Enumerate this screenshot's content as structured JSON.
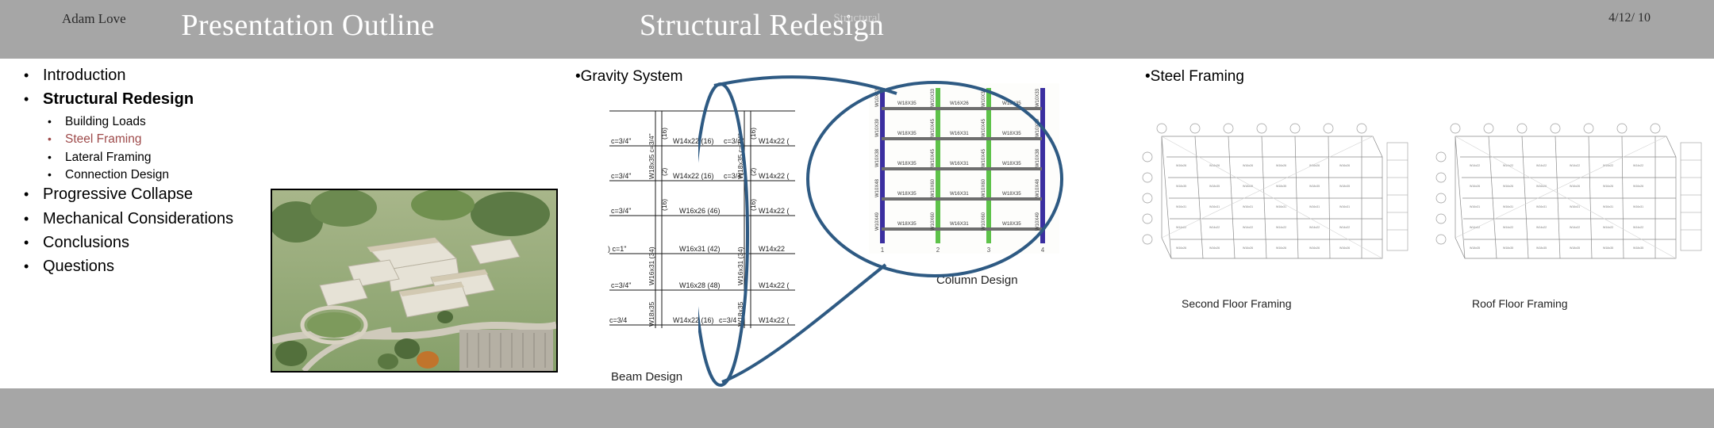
{
  "header": {
    "left_title": "Presentation Outline",
    "right_title": "Structural Redesign",
    "bar_color": "#a6a6a6"
  },
  "outline": {
    "items": [
      {
        "label": "Introduction",
        "level": 1,
        "bold": false,
        "highlight": false
      },
      {
        "label": "Structural Redesign",
        "level": 1,
        "bold": true,
        "highlight": false
      },
      {
        "label": "Building Loads",
        "level": 2,
        "bold": false,
        "highlight": false
      },
      {
        "label": "Steel Framing",
        "level": 2,
        "bold": false,
        "highlight": true
      },
      {
        "label": "Lateral Framing",
        "level": 2,
        "bold": false,
        "highlight": false
      },
      {
        "label": "Connection Design",
        "level": 2,
        "bold": false,
        "highlight": false
      },
      {
        "label": "Progressive Collapse",
        "level": 1,
        "bold": false,
        "highlight": false
      },
      {
        "label": "Mechanical Considerations",
        "level": 1,
        "bold": false,
        "highlight": false
      },
      {
        "label": "Conclusions",
        "level": 1,
        "bold": false,
        "highlight": false
      },
      {
        "label": "Questions",
        "level": 1,
        "bold": false,
        "highlight": false
      }
    ],
    "bullet_glyph": "•",
    "highlight_color": "#9e4a4a"
  },
  "photo": {
    "alt": "aerial-campus-rendering"
  },
  "gravity": {
    "label": "•Gravity System",
    "beam_caption": "Beam Design",
    "column_caption": "Column Design",
    "beam_plan": {
      "rows": [
        {
          "left_note": "c=3/4\"",
          "member": "W14x22 (16)",
          "mid_note": "c=3/4\"",
          "right_member": "W14x22 ("
        },
        {
          "left_note": "c=3/4\"",
          "member": "W14x22 (16)",
          "mid_note": "c=3/4\"",
          "right_member": "W14x22 ("
        },
        {
          "left_note": "c=3/4\"",
          "member": "W16x26 (46)",
          "mid_note": "",
          "right_member": "W14x22 ("
        },
        {
          "left_note": "c=1\"",
          "member": "W16x31 (42)",
          "mid_note": "",
          "right_member": "W14x22"
        },
        {
          "left_note": "c=3/4\"",
          "member": "W16x28 (48)",
          "mid_note": "",
          "right_member": "W14x22 ("
        },
        {
          "left_note": "c=3/4\"",
          "member": "W14x22 (16)",
          "mid_note": "c=3/4\"",
          "right_member": "W14x22 ("
        }
      ],
      "vertical_girders": [
        "W18x35  c=3/4\"",
        "(16)",
        "W18x35  c=3/4\"",
        "(2)",
        "W16x31 (34)",
        "W16x31 (34)",
        "W18x35 c=3/4\""
      ]
    },
    "column_detail": {
      "grid_labels": [
        "1",
        "2",
        "3",
        "4"
      ],
      "beam_labels_bay1": [
        "W18X35",
        "W18X35",
        "W18X35",
        "W18X35",
        "W18X35"
      ],
      "beam_labels_bay2": [
        "W16X26",
        "W16X31",
        "W16X31",
        "W16X31",
        "W16X31"
      ],
      "beam_labels_bay3": [
        "W18X35",
        "W18X35",
        "W18X35",
        "W18X35",
        "W18X35"
      ],
      "column_labels_outer": [
        "W10X33",
        "W10X39",
        "W10X38",
        "W10X48",
        "W10X49"
      ],
      "column_labels_inner": [
        "W10X33",
        "W10X45",
        "W10X45",
        "W10X60",
        "W10X60"
      ],
      "outer_column_color": "#3b2fa0",
      "inner_column_color": "#5ec24a",
      "beam_color": "#6e6e6e"
    },
    "callout_color": "#2e5a83"
  },
  "steel": {
    "label": "•Steel Framing",
    "plans": [
      {
        "caption": "Second Floor Framing"
      },
      {
        "caption": "Roof Floor Framing"
      }
    ]
  },
  "footer": {
    "author": "Adam Love",
    "section": "Structural",
    "date": "4/12/ 10",
    "bar_color": "#a6a6a6"
  }
}
